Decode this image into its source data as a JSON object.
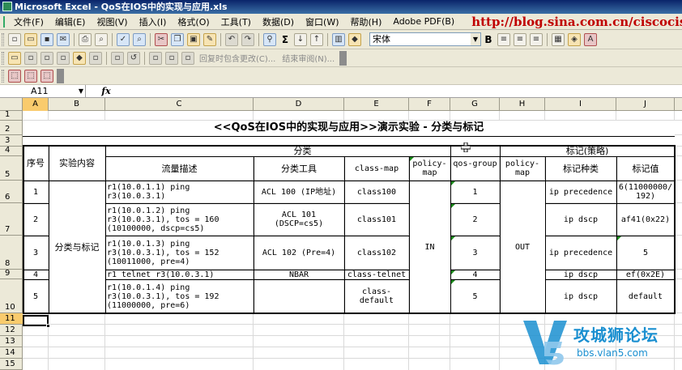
{
  "window": {
    "title": "Microsoft Excel - QoS在IOS中的实现与应用.xls"
  },
  "menu": {
    "items": [
      "文件(F)",
      "编辑(E)",
      "视图(V)",
      "插入(I)",
      "格式(O)",
      "工具(T)",
      "数据(D)",
      "窗口(W)",
      "帮助(H)",
      "Adobe PDF(B)"
    ],
    "url_overlay": "http://blog.sina.com.cn/ciscociscocisco"
  },
  "toolbar": {
    "font_name": "宋体",
    "bold_label": "B",
    "review_reply_label": "回复时包含更改(C)...",
    "review_end_label": "结束审阅(N)..."
  },
  "formula_bar": {
    "name_box": "A11",
    "fx_label": "fx"
  },
  "columns": [
    "A",
    "B",
    "C",
    "D",
    "E",
    "F",
    "G",
    "H",
    "I",
    "J"
  ],
  "rows": [
    "1",
    "2",
    "3",
    "4",
    "5",
    "6",
    "7",
    "8",
    "9",
    "10",
    "11",
    "12",
    "13",
    "14",
    "15"
  ],
  "sheet": {
    "title": "<<QoS在IOS中的实现与应用>>演示实验 - 分类与标记",
    "group_classify": "分类",
    "group_mark": "标记(策略)",
    "headers": {
      "seq": "序号",
      "content": "实验内容",
      "flow": "流量描述",
      "tool": "分类工具",
      "classmap": "class-map",
      "policymap_in": "policy-\nmap",
      "qosgroup": "qos-group",
      "policymap_out": "policy-\nmap",
      "marktype": "标记种类",
      "markval": "标记值"
    },
    "content_merged": "分类与标记",
    "policy_in": "IN",
    "policy_out": "OUT",
    "rows": [
      {
        "seq": "1",
        "flow": "r1(10.0.1.1) ping\nr3(10.0.3.1)",
        "tool": "ACL 100 (IP地址)",
        "classmap": "class100",
        "qosgroup": "1",
        "marktype": "ip precedence",
        "markval": "6(11000000/\n192)"
      },
      {
        "seq": "2",
        "flow": "r1(10.0.1.2) ping\nr3(10.0.3.1), tos = 160\n(10100000, dscp=cs5)",
        "tool": "ACL 101\n(DSCP=cs5)",
        "classmap": "class101",
        "qosgroup": "2",
        "marktype": "ip dscp",
        "markval": "af41(0x22)"
      },
      {
        "seq": "3",
        "flow": "r1(10.0.1.3) ping\nr3(10.0.3.1), tos = 152\n(10011000, pre=4)",
        "tool": "ACL 102 (Pre=4)",
        "classmap": "class102",
        "qosgroup": "3",
        "marktype": "ip precedence",
        "markval": "5"
      },
      {
        "seq": "4",
        "flow": "r1 telnet r3(10.0.3.1)",
        "tool": "NBAR",
        "classmap": "class-telnet",
        "qosgroup": "4",
        "marktype": "ip dscp",
        "markval": "ef(0x2E)"
      },
      {
        "seq": "5",
        "flow": "r1(10.0.1.4) ping\nr3(10.0.3.1), tos = 192\n(11000000, pre=6)",
        "tool": "",
        "classmap": "class-\ndefault",
        "qosgroup": "5",
        "marktype": "ip dscp",
        "markval": "default"
      }
    ]
  },
  "watermark": {
    "title": "攻城狮论坛",
    "subtitle": "bbs.vlan5.com"
  },
  "colors": {
    "title_bar": "#0a246a",
    "chrome": "#ece9d8",
    "selection_header": "#f9cb6d",
    "url_red": "#c00000",
    "watermark_blue": "#1a8fd0"
  }
}
